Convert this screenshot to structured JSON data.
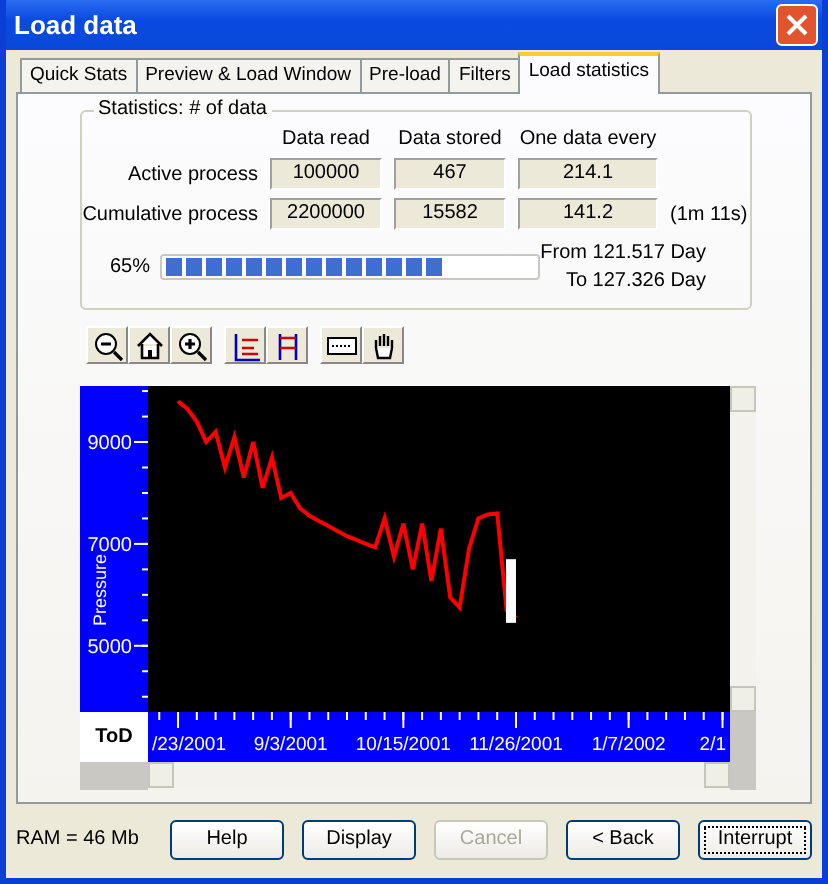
{
  "window": {
    "title": "Load data"
  },
  "tabs": [
    {
      "label": "Quick Stats",
      "selected": false
    },
    {
      "label": "Preview & Load Window",
      "selected": false
    },
    {
      "label": "Pre-load",
      "selected": false
    },
    {
      "label": "Filters",
      "selected": false
    },
    {
      "label": "Load statistics",
      "selected": true
    }
  ],
  "statistics": {
    "title": "Statistics: # of data",
    "columns": [
      "Data read",
      "Data stored",
      "One data every"
    ],
    "rows": [
      {
        "label": "Active process",
        "values": [
          "100000",
          "467",
          "214.1"
        ]
      },
      {
        "label": "Cumulative process",
        "values": [
          "2200000",
          "15582",
          "141.2"
        ],
        "note": "(1m 11s)"
      }
    ]
  },
  "progress": {
    "percent": "65%",
    "level": 0.65,
    "from": "From 121.517 Day",
    "to": "To 127.326 Day"
  },
  "chart": {
    "corner_label": "ToD",
    "chart_data": {
      "type": "line",
      "ylabel": "Pressure",
      "ylim": [
        3700,
        10100
      ],
      "categories": [
        null,
        null,
        null,
        "/23/2001",
        null,
        null,
        null,
        null,
        null,
        null,
        null,
        null,
        null,
        null,
        null,
        "9/3/2001",
        null,
        null,
        null,
        null,
        null,
        null,
        null,
        null,
        null,
        null,
        null,
        "10/15/2001",
        null,
        null,
        null,
        null,
        null,
        null,
        null,
        null,
        null,
        null,
        null,
        "11/26/2001",
        null,
        null,
        null,
        null,
        null,
        null,
        null,
        null,
        null,
        null,
        null,
        "1/7/2002",
        null,
        null,
        null,
        null,
        null,
        null,
        null,
        null,
        null,
        "2/1"
      ],
      "yticks": [
        5000,
        7000,
        9000
      ],
      "series": [
        {
          "color": "#ff0000",
          "values": [
            null,
            null,
            null,
            9800,
            9650,
            9400,
            9000,
            9200,
            8500,
            9100,
            8300,
            9000,
            8100,
            8700,
            7900,
            8000,
            7700,
            7550,
            7450,
            7350,
            7250,
            7150,
            7080,
            7000,
            6930,
            7500,
            6750,
            7400,
            6500,
            7400,
            6270,
            7300,
            5950,
            5750,
            6900,
            7500,
            7580,
            7600,
            5700,
            5550,
            null,
            null,
            null,
            null,
            null,
            null,
            null,
            null,
            null,
            null,
            null,
            null,
            null,
            null,
            null,
            null,
            null,
            null,
            null,
            null,
            null,
            null
          ]
        }
      ]
    }
  },
  "status": {
    "ram": "RAM = 46 Mb"
  },
  "buttons": [
    {
      "label": "Help",
      "disabled": false,
      "focused": false
    },
    {
      "label": "Display",
      "disabled": false,
      "focused": false
    },
    {
      "label": "Cancel",
      "disabled": true,
      "focused": false
    },
    {
      "label": "< Back",
      "disabled": false,
      "focused": false
    },
    {
      "label": "Interrupt",
      "disabled": false,
      "focused": true
    }
  ]
}
